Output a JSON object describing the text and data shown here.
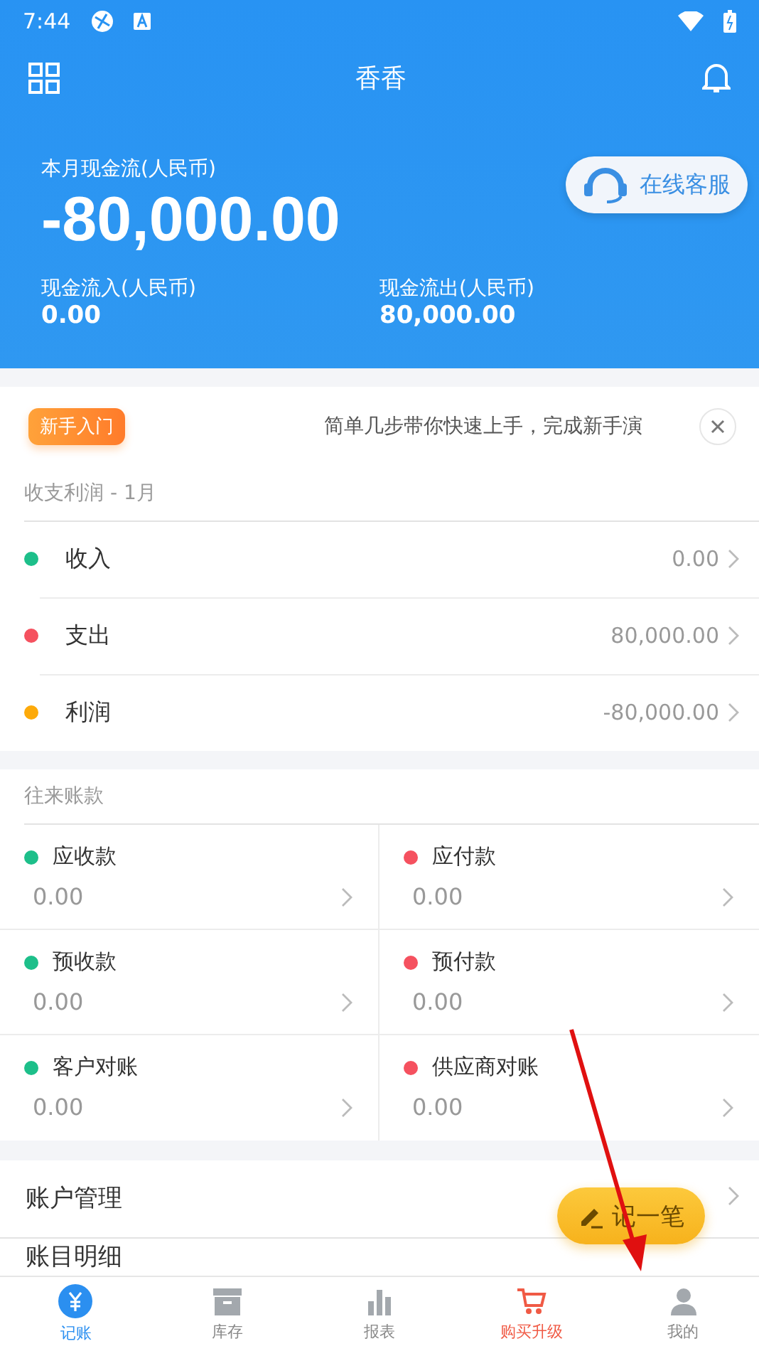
{
  "status_bar": {
    "time": "7:44"
  },
  "header": {
    "title": "香香"
  },
  "summary": {
    "label": "本月现金流(人民币)",
    "amount": "-80,000.00",
    "service_button": "在线客服",
    "inflow_label": "现金流入(人民币)",
    "inflow": "0.00",
    "outflow_label": "现金流出(人民币)",
    "outflow": "80,000.00"
  },
  "guide": {
    "badge": "新手入门",
    "text": "简单几步带你快速上手，完成新手演"
  },
  "profit": {
    "title": "收支利润 - 1月",
    "rows": [
      {
        "label": "收入",
        "value": "0.00",
        "color": "#1dbf8a"
      },
      {
        "label": "支出",
        "value": "80,000.00",
        "color": "#f5515f"
      },
      {
        "label": "利润",
        "value": "-80,000.00",
        "color": "#fdaa0a"
      }
    ]
  },
  "accounts": {
    "title": "往来账款",
    "cells": [
      {
        "label": "应收款",
        "value": "0.00",
        "color": "#1dbf8a"
      },
      {
        "label": "应付款",
        "value": "0.00",
        "color": "#f5515f"
      },
      {
        "label": "预收款",
        "value": "0.00",
        "color": "#1dbf8a"
      },
      {
        "label": "预付款",
        "value": "0.00",
        "color": "#f5515f"
      },
      {
        "label": "客户对账",
        "value": "0.00",
        "color": "#1dbf8a"
      },
      {
        "label": "供应商对账",
        "value": "0.00",
        "color": "#f5515f"
      }
    ]
  },
  "menu": [
    {
      "label": "账户管理"
    },
    {
      "label": "账目明细"
    }
  ],
  "fab": {
    "label": "记一笔"
  },
  "tabs": [
    {
      "label": "记账",
      "selected": true,
      "kind": "normal"
    },
    {
      "label": "库存",
      "selected": false,
      "kind": "normal"
    },
    {
      "label": "报表",
      "selected": false,
      "kind": "normal"
    },
    {
      "label": "购买升级",
      "selected": false,
      "kind": "promo"
    },
    {
      "label": "我的",
      "selected": false,
      "kind": "normal"
    }
  ]
}
